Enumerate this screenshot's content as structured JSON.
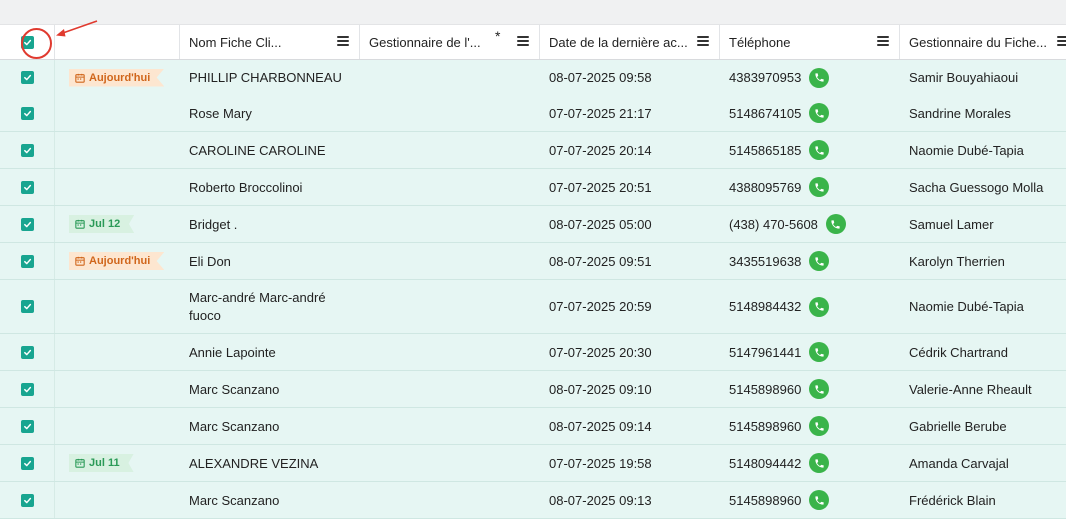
{
  "columns": [
    {
      "label": ""
    },
    {
      "label": ""
    },
    {
      "label": "Nom Fiche Cli..."
    },
    {
      "label": "Gestionnaire de l'..."
    },
    {
      "label": "Date de la dernière ac..."
    },
    {
      "label": "Téléphone"
    },
    {
      "label": "Gestionnaire du Fiche..."
    }
  ],
  "required_marker": "*",
  "colors": {
    "accent": "#18a590",
    "row_bg": "#e6f6f3",
    "phone": "#3ab44a",
    "tag_today": "#d0661b",
    "tag_date": "#2a9a57",
    "annotation": "#e03a2f"
  },
  "rows": [
    {
      "tag": "Aujourd'hui",
      "tag_type": "orange",
      "name": "PHILLIP CHARBONNEAU",
      "manager": "",
      "date": "08-07-2025 09:58",
      "phone": "4383970953",
      "owner": "Samir Bouyahiaoui"
    },
    {
      "tag": "",
      "tag_type": "",
      "name": "Rose Mary",
      "manager": "",
      "date": "07-07-2025 21:17",
      "phone": "5148674105",
      "owner": "Sandrine Morales"
    },
    {
      "tag": "",
      "tag_type": "",
      "name": "CAROLINE CAROLINE",
      "manager": "",
      "date": "07-07-2025 20:14",
      "phone": "5145865185",
      "owner": "Naomie Dubé-Tapia"
    },
    {
      "tag": "",
      "tag_type": "",
      "name": "Roberto Broccolinoi",
      "manager": "",
      "date": "07-07-2025 20:51",
      "phone": "4388095769",
      "owner": "Sacha Guessogo Molla"
    },
    {
      "tag": "Jul 12",
      "tag_type": "green",
      "name": "Bridget .",
      "manager": "",
      "date": "08-07-2025 05:00",
      "phone": "(438) 470-5608",
      "owner": "Samuel Lamer"
    },
    {
      "tag": "Aujourd'hui",
      "tag_type": "orange",
      "name": "Eli Don",
      "manager": "",
      "date": "08-07-2025 09:51",
      "phone": "3435519638",
      "owner": "Karolyn Therrien"
    },
    {
      "tag": "",
      "tag_type": "",
      "name": "Marc-andré Marc-andré fuoco",
      "manager": "",
      "date": "07-07-2025 20:59",
      "phone": "5148984432",
      "owner": "Naomie Dubé-Tapia"
    },
    {
      "tag": "",
      "tag_type": "",
      "name": "Annie Lapointe",
      "manager": "",
      "date": "07-07-2025 20:30",
      "phone": "5147961441",
      "owner": "Cédrik Chartrand"
    },
    {
      "tag": "",
      "tag_type": "",
      "name": "Marc Scanzano",
      "manager": "",
      "date": "08-07-2025 09:10",
      "phone": "5145898960",
      "owner": "Valerie-Anne Rheault"
    },
    {
      "tag": "",
      "tag_type": "",
      "name": "Marc Scanzano",
      "manager": "",
      "date": "08-07-2025 09:14",
      "phone": "5145898960",
      "owner": "Gabrielle Berube"
    },
    {
      "tag": "Jul 11",
      "tag_type": "green",
      "name": "ALEXANDRE VEZINA",
      "manager": "",
      "date": "07-07-2025 19:58",
      "phone": "5148094442",
      "owner": "Amanda Carvajal"
    },
    {
      "tag": "",
      "tag_type": "",
      "name": "Marc Scanzano",
      "manager": "",
      "date": "08-07-2025 09:13",
      "phone": "5145898960",
      "owner": "Frédérick Blain"
    }
  ]
}
